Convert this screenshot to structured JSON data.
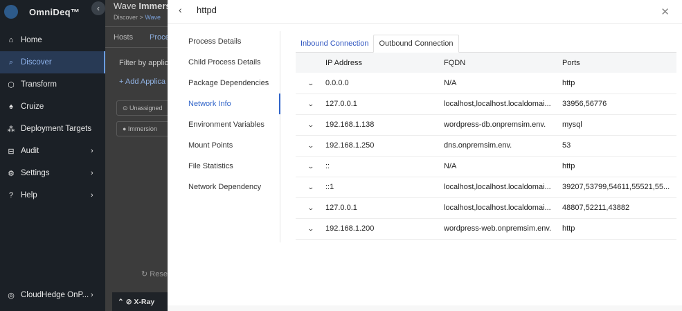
{
  "sidebar": {
    "brand": "OmniDeq™",
    "collapse_icon": "‹",
    "items": [
      {
        "label": "Home",
        "icon": "⌂",
        "arrow": ""
      },
      {
        "label": "Discover",
        "icon": "⌕",
        "arrow": ""
      },
      {
        "label": "Transform",
        "icon": "⬡",
        "arrow": ""
      },
      {
        "label": "Cruize",
        "icon": "♠",
        "arrow": ""
      },
      {
        "label": "Deployment Targets",
        "icon": "⁂",
        "arrow": ""
      },
      {
        "label": "Audit",
        "icon": "⊟",
        "arrow": "›"
      },
      {
        "label": "Settings",
        "icon": "⚙",
        "arrow": "›"
      },
      {
        "label": "Help",
        "icon": "?",
        "arrow": "›"
      }
    ],
    "account": {
      "label": "CloudHedge OnP...",
      "icon": "◎",
      "arrow": "›"
    }
  },
  "main": {
    "title_prefix": "Wave",
    "title": "Immers",
    "breadcrumb_root": "Discover",
    "breadcrumb_sep": ">",
    "breadcrumb_current": "Wave",
    "tab_hosts": "Hosts",
    "tab_proc": "Proce",
    "filter": "Filter by applic",
    "add_app": "+ Add Applica",
    "chip_unassigned": "⊙ Unassigned",
    "chip_immersion": "● Immersion",
    "reset": "↻ Rese",
    "xray": "⌃ ⊘ X-Ray"
  },
  "drawer": {
    "title": "httpd",
    "back_icon": "‹",
    "close_icon": "✕",
    "menu": [
      "Process Details",
      "Child Process Details",
      "Package Dependencies",
      "Network Info",
      "Environment Variables",
      "Mount Points",
      "File Statistics",
      "Network Dependency"
    ],
    "active_menu_index": 3,
    "tabs": [
      "Inbound Connection",
      "Outbound Connection"
    ],
    "active_tab_index": 1,
    "table": {
      "headers": [
        "IP Address",
        "FQDN",
        "Ports"
      ],
      "rows": [
        {
          "ip": "0.0.0.0",
          "fqdn": "N/A",
          "ports": "http"
        },
        {
          "ip": "127.0.0.1",
          "fqdn": "localhost,localhost.localdomai...",
          "ports": "33956,56776"
        },
        {
          "ip": "192.168.1.138",
          "fqdn": "wordpress-db.onpremsim.env.",
          "ports": "mysql"
        },
        {
          "ip": "192.168.1.250",
          "fqdn": "dns.onpremsim.env.",
          "ports": "53"
        },
        {
          "ip": "::",
          "fqdn": "N/A",
          "ports": "http"
        },
        {
          "ip": "::1",
          "fqdn": "localhost,localhost.localdomai...",
          "ports": "39207,53799,54611,55521,55..."
        },
        {
          "ip": "127.0.0.1",
          "fqdn": "localhost,localhost.localdomai...",
          "ports": "48807,52211,43882"
        },
        {
          "ip": "192.168.1.200",
          "fqdn": "wordpress-web.onpremsim.env.",
          "ports": "http"
        }
      ],
      "expand_icon": "⌄"
    }
  },
  "colors": {
    "accent": "#2f63c8",
    "sidebar_bg": "#1b2026",
    "overlay_bg": "#3c3c3c"
  }
}
